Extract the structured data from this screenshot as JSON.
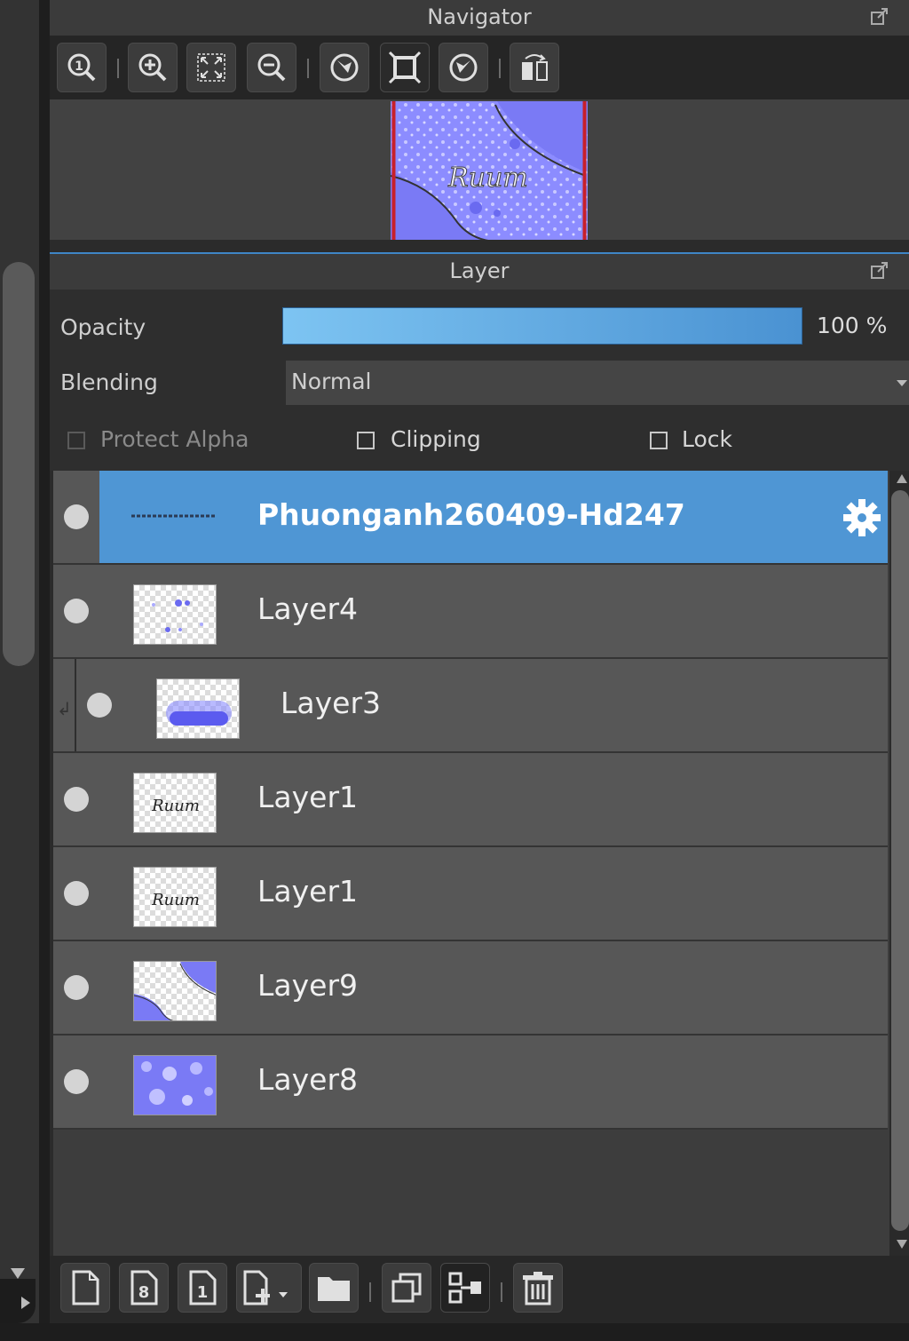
{
  "navigator": {
    "title": "Navigator",
    "toolbar": [
      {
        "icon": "zoom-actual-size-icon"
      },
      {
        "icon": "zoom-in-icon"
      },
      {
        "icon": "zoom-fit-icon"
      },
      {
        "icon": "zoom-out-icon"
      },
      {
        "icon": "rotate-left-icon"
      },
      {
        "icon": "fit-window-icon"
      },
      {
        "icon": "rotate-right-icon"
      },
      {
        "icon": "flip-horizontal-icon"
      }
    ],
    "preview_text": "Ruum"
  },
  "layer_panel": {
    "title": "Layer",
    "opacity_label": "Opacity",
    "opacity_value": "100 %",
    "opacity_fraction": 1.0,
    "blending_label": "Blending",
    "blending_value": "Normal",
    "protect_alpha_label": "Protect Alpha",
    "clipping_label": "Clipping",
    "lock_label": "Lock",
    "layers": [
      {
        "name": "Phuonganh260409-Hd247",
        "selected": true
      },
      {
        "name": "Layer4"
      },
      {
        "name": "Layer3",
        "clipped": true
      },
      {
        "name": "Layer1"
      },
      {
        "name": "Layer1"
      },
      {
        "name": "Layer9"
      },
      {
        "name": "Layer8"
      }
    ],
    "thumb_text": "Ruum"
  },
  "bottom_toolbar": [
    {
      "icon": "new-layer-icon"
    },
    {
      "icon": "new-8bit-layer-icon"
    },
    {
      "icon": "new-1bit-layer-icon"
    },
    {
      "icon": "add-layer-menu-icon"
    },
    {
      "icon": "new-folder-icon"
    },
    {
      "icon": "duplicate-layer-icon"
    },
    {
      "icon": "merge-down-icon"
    },
    {
      "icon": "delete-layer-icon"
    }
  ],
  "colors": {
    "accent": "#4f96d4",
    "preview_purple": "#8c8cff",
    "preview_border": "#c8202a"
  }
}
